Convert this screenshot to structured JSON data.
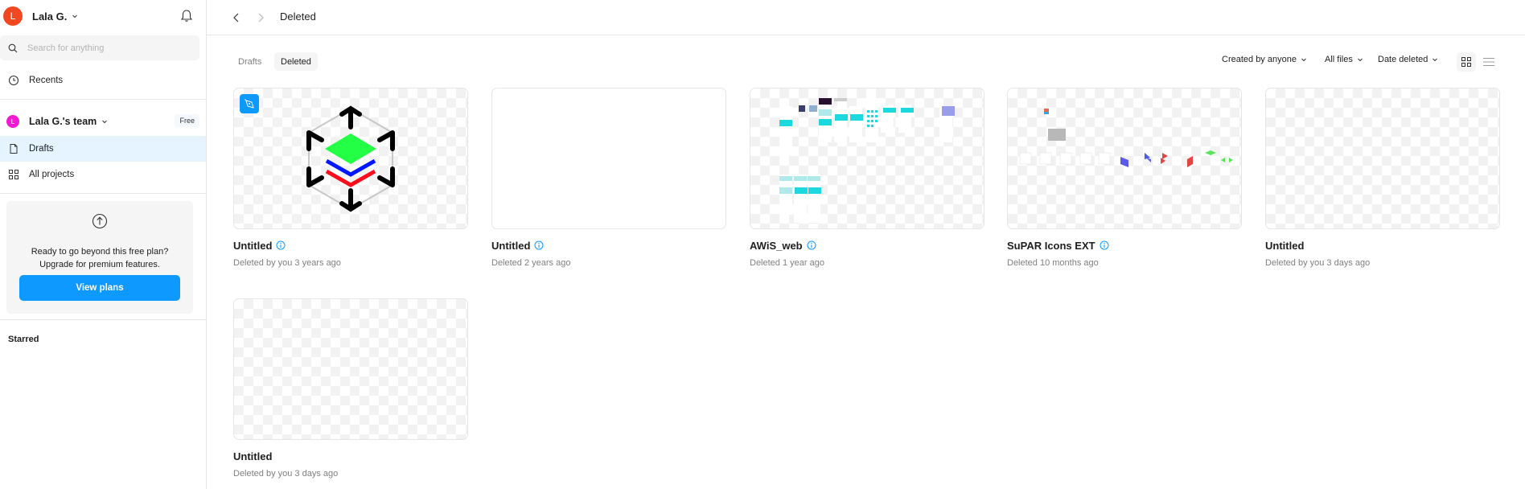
{
  "user": {
    "initial": "L",
    "name": "Lala G.",
    "avatar_color": "#f24822"
  },
  "search": {
    "placeholder": "Search for anything",
    "value": ""
  },
  "sidebar": {
    "recents_label": "Recents",
    "team": {
      "initial": "L",
      "name": "Lala G.'s team",
      "badge": "Free",
      "avatar_color": "#f31bd1"
    },
    "items": [
      {
        "label": "Drafts",
        "icon": "file-icon",
        "active": true
      },
      {
        "label": "All projects",
        "icon": "grid-icon",
        "active": false
      }
    ],
    "upgrade": {
      "line1": "Ready to go beyond this free plan?",
      "line2": "Upgrade for premium features.",
      "button_label": "View plans"
    },
    "starred_label": "Starred"
  },
  "header": {
    "title": "Deleted"
  },
  "tabs": [
    {
      "label": "Drafts",
      "active": false
    },
    {
      "label": "Deleted",
      "active": true
    }
  ],
  "filters": {
    "creator": "Created by anyone",
    "file_type": "All files",
    "sort": "Date deleted",
    "view": "grid"
  },
  "files": [
    {
      "title": "Untitled",
      "subtitle": "Deleted by you 3 years ago",
      "has_info": true,
      "thumbnail": "cube-layers-icon-art",
      "badge": "pen-icon"
    },
    {
      "title": "Untitled",
      "subtitle": "Deleted 2 years ago",
      "has_info": true,
      "thumbnail": "blank-white"
    },
    {
      "title": "AWiS_web",
      "subtitle": "Deleted 1 year ago",
      "has_info": true,
      "thumbnail": "web-screens-overview"
    },
    {
      "title": "SuPAR Icons EXT",
      "subtitle": "Deleted 10 months ago",
      "has_info": true,
      "thumbnail": "icon-set-overview"
    },
    {
      "title": "Untitled",
      "subtitle": "Deleted by you 3 days ago",
      "has_info": false,
      "thumbnail": "empty-transparent"
    },
    {
      "title": "Untitled",
      "subtitle": "Deleted by you 3 days ago",
      "has_info": false,
      "thumbnail": "empty-transparent"
    }
  ],
  "colors": {
    "accent": "#0d99ff",
    "active_nav": "#e5f4ff",
    "muted_text": "#808080"
  }
}
